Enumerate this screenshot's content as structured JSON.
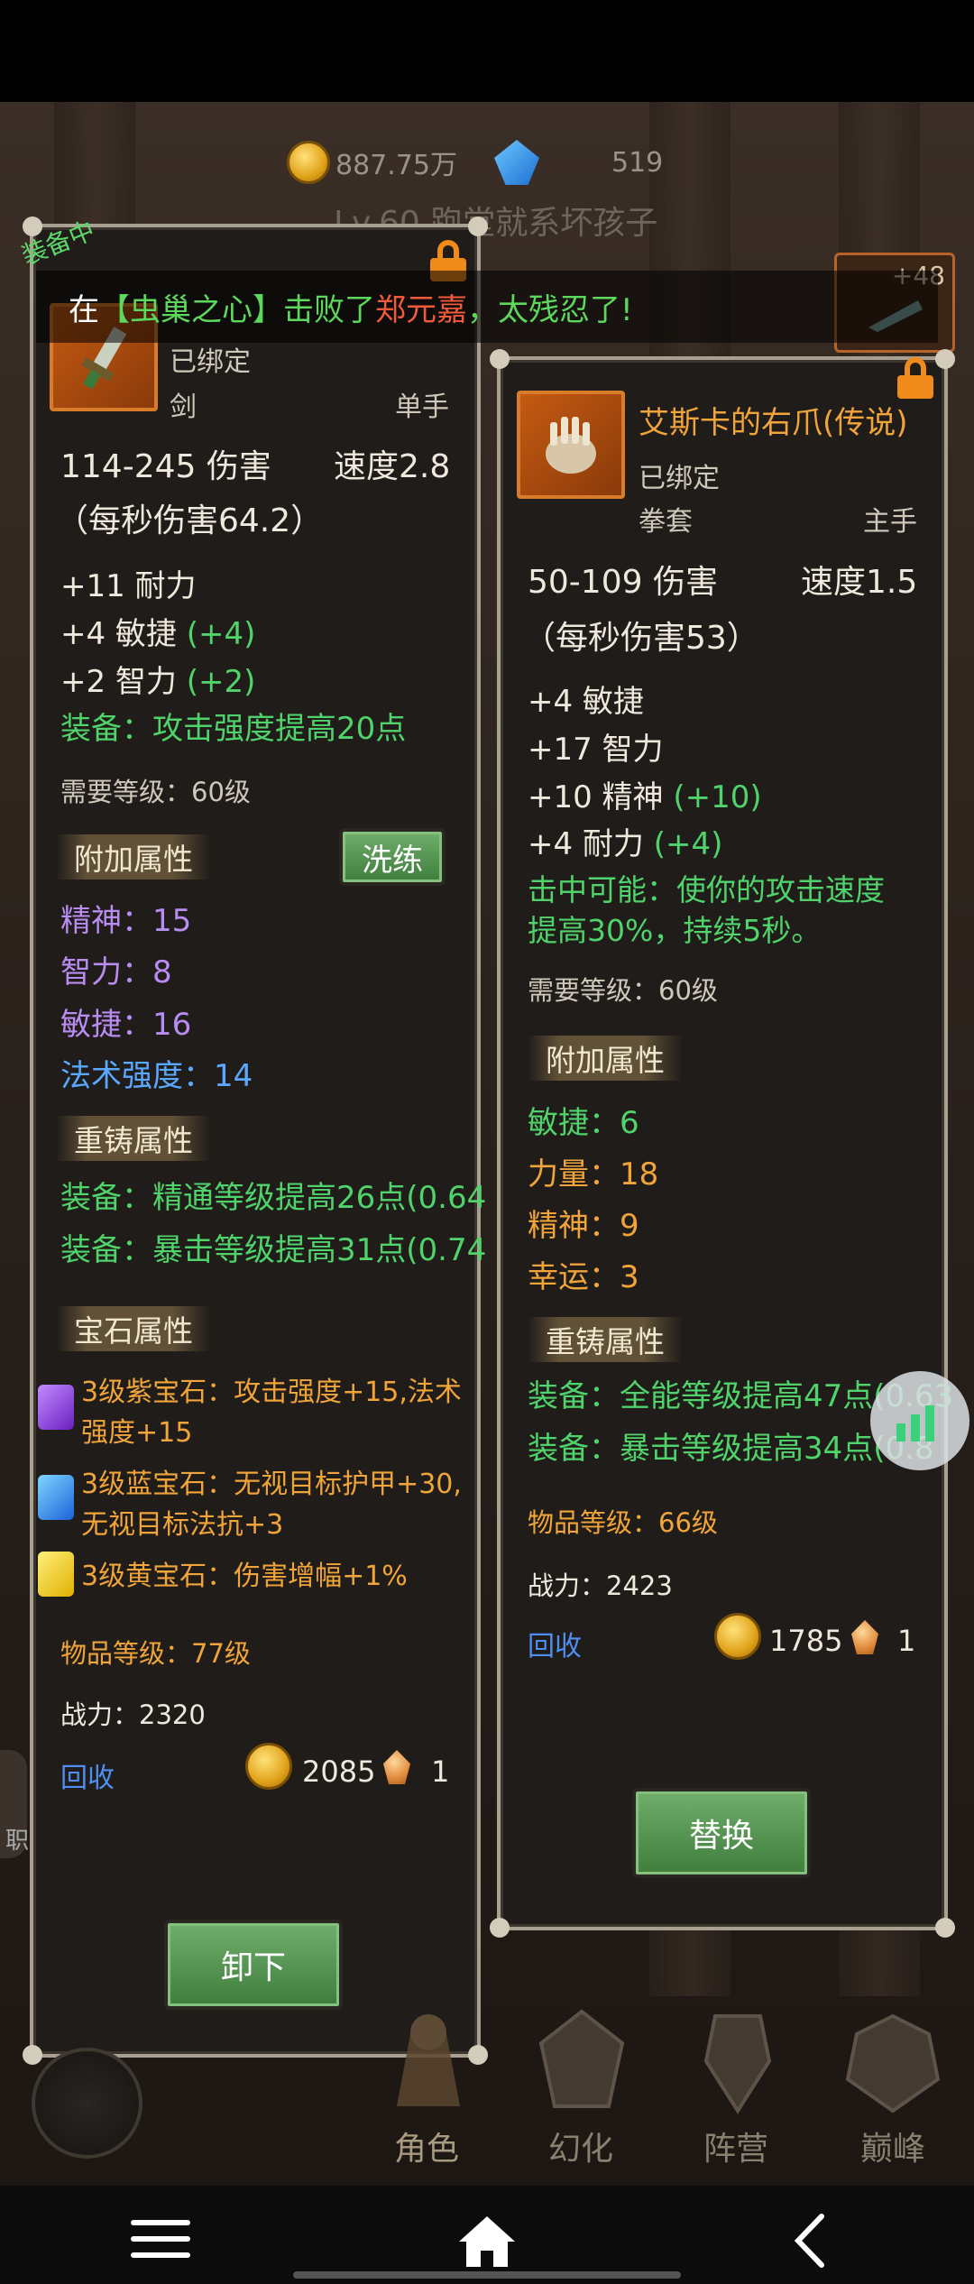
{
  "currency": {
    "gold": "887.75万",
    "diamond": "519"
  },
  "player": {
    "level_name": "Lv.60 跑堂就系坏孩子"
  },
  "equipping_badge": "装备中",
  "ticker": {
    "prefix": "在",
    "dungeon": "【虫巢之心】",
    "verb": "击败了",
    "name": "郑元嘉",
    "suffix": "，太残忍了!"
  },
  "left_item": {
    "bound": "已绑定",
    "type": "剑",
    "hand": "单手",
    "damage": "114-245 伤害",
    "speed": "速度2.8",
    "dps": "（每秒伤害64.2）",
    "stats": [
      {
        "base": "+11 耐力",
        "bonus": ""
      },
      {
        "base": "+4 敏捷",
        "bonus": "(+4)"
      },
      {
        "base": "+2 智力",
        "bonus": "(+2)"
      }
    ],
    "equip_effect": "装备：攻击强度提高20点",
    "required_level": "需要等级：60级",
    "extra_title": "附加属性",
    "reroll_label": "洗练",
    "extra_stats": [
      {
        "label": "精神：15",
        "color": "purple"
      },
      {
        "label": "智力：8",
        "color": "purple"
      },
      {
        "label": "敏捷：16",
        "color": "purple"
      },
      {
        "label": "法术强度：14",
        "color": "blue"
      }
    ],
    "reforge_title": "重铸属性",
    "reforge": [
      "装备：精通等级提高26点(0.64",
      "装备：暴击等级提高31点(0.74"
    ],
    "gem_title": "宝石属性",
    "gems": [
      {
        "line1": "3级紫宝石：攻击强度+15,法术",
        "line2": "强度+15",
        "color": "#9a55e6"
      },
      {
        "line1": "3级蓝宝石：无视目标护甲+30,",
        "line2": "无视目标法抗+3",
        "color": "#2f8cf0"
      },
      {
        "line1": "3级黄宝石：伤害增幅+1%",
        "line2": "",
        "color": "#f2c500"
      }
    ],
    "item_level": "物品等级：77级",
    "power": "战力：2320",
    "recycle": "回收",
    "gold": "2085",
    "shard": "1",
    "button": "卸下"
  },
  "right_item": {
    "name": "艾斯卡的右爪(传说)",
    "bound": "已绑定",
    "type": "拳套",
    "hand": "主手",
    "damage": "50-109 伤害",
    "speed": "速度1.5",
    "dps": "（每秒伤害53）",
    "stats": [
      {
        "base": "+4 敏捷",
        "bonus": ""
      },
      {
        "base": "+17 智力",
        "bonus": ""
      },
      {
        "base": "+10 精神",
        "bonus": "(+10)"
      },
      {
        "base": "+4 耐力",
        "bonus": "(+4)"
      }
    ],
    "proc_line1": "击中可能：使你的攻击速度",
    "proc_line2": "提高30%，持续5秒。",
    "required_level": "需要等级：60级",
    "extra_title": "附加属性",
    "extra_stats": [
      {
        "label": "敏捷：6",
        "color": "green"
      },
      {
        "label": "力量：18",
        "color": "orange"
      },
      {
        "label": "精神：9",
        "color": "orange"
      },
      {
        "label": "幸运：3",
        "color": "orange"
      }
    ],
    "reforge_title": "重铸属性",
    "reforge": [
      "装备：全能等级提高47点(0.63",
      "装备：暴击等级提高34点(0.8"
    ],
    "item_level": "物品等级：66级",
    "power": "战力：2423",
    "recycle": "回收",
    "gold": "1785",
    "shard": "1",
    "button": "替换"
  },
  "bag_badge": "+48",
  "tabs": [
    {
      "label": "角色"
    },
    {
      "label": "幻化"
    },
    {
      "label": "阵营"
    },
    {
      "label": "巅峰"
    }
  ],
  "side_label": "职"
}
